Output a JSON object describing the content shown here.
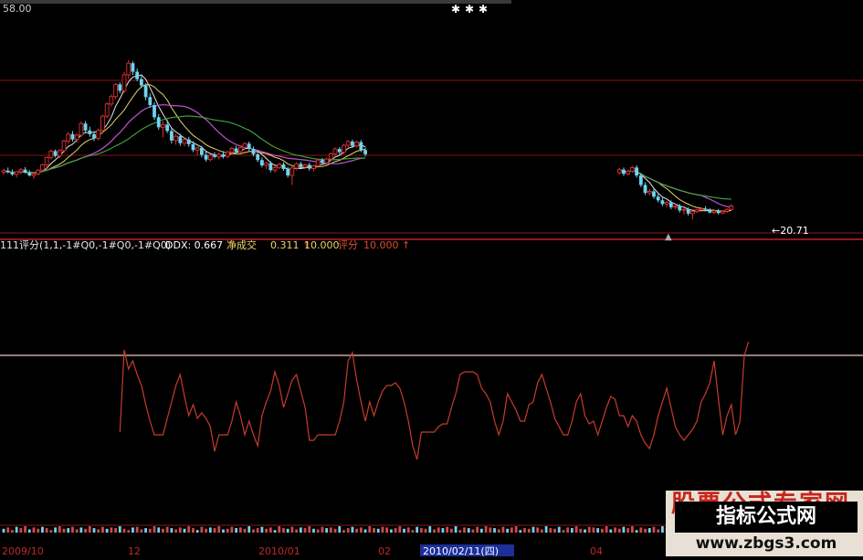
{
  "colors": {
    "background": "#000000",
    "grid": "#8a1414",
    "candle_up": "#e03030",
    "candle_down": "#6fd3ef",
    "ma_white": "#e6e6e6",
    "ma_yellow": "#e8d56a",
    "ma_purple": "#b04fc0",
    "ma_green": "#3fa83f",
    "score_line": "#c83c2c",
    "ref_line": "#e8c8c0",
    "ddx_label": "#ffffff",
    "net_label": "#e8d56a",
    "score_label": "#d84c30"
  },
  "header": {
    "price_top": "58.00",
    "stars": [
      "✱",
      "✱",
      "✱"
    ]
  },
  "indicator_bar": {
    "name": "111评分(1,1,-1#Q0,-1#Q0,-1#Q0)",
    "ddx_label": "DDX: 0.667",
    "ddx_arrow": "↑",
    "net_label": "净成交",
    "net_value": "0.311",
    "net_arrow": "↑",
    "net_value2": "10.000",
    "score_label": "评分",
    "score_value": "10.000",
    "score_arrow": "↑"
  },
  "main_chart": {
    "low_label": "←20.71"
  },
  "x_axis": {
    "labels": [
      "2009/10",
      "12",
      "2010/01",
      "02",
      "2010/02/11(四)",
      "04"
    ]
  },
  "watermark": {
    "top_text": "股票公式专家网",
    "title": "指标公式网",
    "url": "www.zbgs3.com"
  },
  "chart_data": [
    {
      "type": "candlestick",
      "ylim": [
        19,
        58
      ],
      "segments": [
        {
          "first_index": 0,
          "candles": [
            [
              29.6,
              30.3,
              29.1,
              29.9
            ],
            [
              29.9,
              30.5,
              29.4,
              29.6
            ],
            [
              29.6,
              30.1,
              28.9,
              29.2
            ],
            [
              29.2,
              29.9,
              28.6,
              29.7
            ],
            [
              29.7,
              30.4,
              29.2,
              30.1
            ],
            [
              30.1,
              30.6,
              29.4,
              29.5
            ],
            [
              29.5,
              30.0,
              28.8,
              29.0
            ],
            [
              29.0,
              29.6,
              28.4,
              29.3
            ],
            [
              29.3,
              30.2,
              29.0,
              30.0
            ],
            [
              30.0,
              31.2,
              29.7,
              31.0
            ],
            [
              31.0,
              32.6,
              30.6,
              32.4
            ],
            [
              32.4,
              33.9,
              32.0,
              33.6
            ],
            [
              33.6,
              33.9,
              32.4,
              32.7
            ],
            [
              32.7,
              34.0,
              32.2,
              33.7
            ],
            [
              33.7,
              35.8,
              33.3,
              35.5
            ],
            [
              35.5,
              37.2,
              35.0,
              36.8
            ],
            [
              36.8,
              37.4,
              35.4,
              35.8
            ],
            [
              35.8,
              37.0,
              35.2,
              36.6
            ],
            [
              36.6,
              39.2,
              36.2,
              38.8
            ],
            [
              38.8,
              39.3,
              37.0,
              37.5
            ],
            [
              37.5,
              38.2,
              36.3,
              36.8
            ],
            [
              36.8,
              37.4,
              35.5,
              36.0
            ],
            [
              36.0,
              37.9,
              35.6,
              37.5
            ],
            [
              37.5,
              40.5,
              37.1,
              40.2
            ],
            [
              40.2,
              42.8,
              39.8,
              42.5
            ],
            [
              42.5,
              44.3,
              42.0,
              43.9
            ],
            [
              43.9,
              46.5,
              43.4,
              46.2
            ],
            [
              46.2,
              46.6,
              44.5,
              45.0
            ],
            [
              45.0,
              48.5,
              44.6,
              48.0
            ],
            [
              48.0,
              50.8,
              47.2,
              50.2
            ],
            [
              50.2,
              50.6,
              48.0,
              48.6
            ],
            [
              48.6,
              49.2,
              46.8,
              47.2
            ],
            [
              47.2,
              48.0,
              45.5,
              46.0
            ],
            [
              46.0,
              46.4,
              43.2,
              43.8
            ],
            [
              43.8,
              44.5,
              41.8,
              42.3
            ],
            [
              42.3,
              42.8,
              39.5,
              40.0
            ],
            [
              40.0,
              40.6,
              37.6,
              38.1
            ],
            [
              38.1,
              39.2,
              36.2,
              38.6
            ],
            [
              38.6,
              39.5,
              37.0,
              37.4
            ],
            [
              37.4,
              37.9,
              35.0,
              35.6
            ],
            [
              35.6,
              36.8,
              34.8,
              36.4
            ],
            [
              36.4,
              36.9,
              34.6,
              35.1
            ],
            [
              35.1,
              36.2,
              34.5,
              35.8
            ],
            [
              35.8,
              36.3,
              34.4,
              34.9
            ],
            [
              34.9,
              35.4,
              33.4,
              33.8
            ],
            [
              33.8,
              34.5,
              32.8,
              34.2
            ],
            [
              34.2,
              34.6,
              32.4,
              32.9
            ],
            [
              32.9,
              33.5,
              31.6,
              32.0
            ],
            [
              32.0,
              33.0,
              31.6,
              32.8
            ],
            [
              32.8,
              33.4,
              32.2,
              32.5
            ],
            [
              32.5,
              33.3,
              32.0,
              33.0
            ],
            [
              33.0,
              33.6,
              32.2,
              32.6
            ],
            [
              32.6,
              33.7,
              32.2,
              33.4
            ],
            [
              33.4,
              34.4,
              33.0,
              34.1
            ],
            [
              34.1,
              34.6,
              33.2,
              33.5
            ],
            [
              33.5,
              34.6,
              33.2,
              34.3
            ],
            [
              34.3,
              35.3,
              33.9,
              35.0
            ],
            [
              35.0,
              35.4,
              33.6,
              34.0
            ],
            [
              34.0,
              34.5,
              32.6,
              33.0
            ],
            [
              33.0,
              33.5,
              31.5,
              31.9
            ],
            [
              31.9,
              32.4,
              30.5,
              30.9
            ],
            [
              30.9,
              31.6,
              30.2,
              31.3
            ],
            [
              31.3,
              31.7,
              29.6,
              30.0
            ],
            [
              30.0,
              30.8,
              29.5,
              30.5
            ],
            [
              30.5,
              31.4,
              30.2,
              31.1
            ],
            [
              31.1,
              31.5,
              29.9,
              30.2
            ],
            [
              30.2,
              30.6,
              28.6,
              29.0
            ],
            [
              29.0,
              30.8,
              27.2,
              30.4
            ],
            [
              30.4,
              31.5,
              30.0,
              31.2
            ],
            [
              31.2,
              31.6,
              30.3,
              30.6
            ],
            [
              30.6,
              31.3,
              30.2,
              31.0
            ],
            [
              31.0,
              31.4,
              29.9,
              30.3
            ],
            [
              30.3,
              31.0,
              29.8,
              30.8
            ],
            [
              30.8,
              32.2,
              30.5,
              31.9
            ],
            [
              31.9,
              32.3,
              31.0,
              31.4
            ],
            [
              31.4,
              32.4,
              31.0,
              32.1
            ],
            [
              32.1,
              33.4,
              31.8,
              33.1
            ],
            [
              33.1,
              34.3,
              32.7,
              34.0
            ],
            [
              34.0,
              34.4,
              33.0,
              33.4
            ],
            [
              33.4,
              35.0,
              33.0,
              34.7
            ],
            [
              34.7,
              35.7,
              34.2,
              35.4
            ],
            [
              35.4,
              35.8,
              34.2,
              34.6
            ],
            [
              34.6,
              35.6,
              34.2,
              35.3
            ],
            [
              35.3,
              35.7,
              33.4,
              33.8
            ],
            [
              33.8,
              34.3,
              32.6,
              33.0
            ]
          ]
        },
        {
          "first_index": 143,
          "candles": [
            [
              29.5,
              30.4,
              29.2,
              30.1
            ],
            [
              30.1,
              30.5,
              28.9,
              29.3
            ],
            [
              29.3,
              30.1,
              29.0,
              29.8
            ],
            [
              29.8,
              30.8,
              29.5,
              30.5
            ],
            [
              30.5,
              30.9,
              28.6,
              29.0
            ],
            [
              29.0,
              29.4,
              26.8,
              27.2
            ],
            [
              27.2,
              27.7,
              25.3,
              25.7
            ],
            [
              25.7,
              26.4,
              25.2,
              26.0
            ],
            [
              26.0,
              26.5,
              24.6,
              25.0
            ],
            [
              25.0,
              25.5,
              23.9,
              24.3
            ],
            [
              24.3,
              24.8,
              23.2,
              23.6
            ],
            [
              23.6,
              24.2,
              23.0,
              23.9
            ],
            [
              23.9,
              24.3,
              22.6,
              23.0
            ],
            [
              23.0,
              23.6,
              22.6,
              23.2
            ],
            [
              23.2,
              23.6,
              22.0,
              22.4
            ],
            [
              22.4,
              22.9,
              21.6,
              22.6
            ],
            [
              22.6,
              23.0,
              21.4,
              21.8
            ],
            [
              21.8,
              22.4,
              20.7,
              22.2
            ],
            [
              22.2,
              22.7,
              21.9,
              22.5
            ],
            [
              22.5,
              23.0,
              22.1,
              22.7
            ],
            [
              22.7,
              23.2,
              22.2,
              22.5
            ],
            [
              22.5,
              22.8,
              21.8,
              22.0
            ],
            [
              22.0,
              22.6,
              21.7,
              22.3
            ],
            [
              22.3,
              22.7,
              21.6,
              21.9
            ],
            [
              21.9,
              22.4,
              21.7,
              22.2
            ],
            [
              22.2,
              22.8,
              21.9,
              22.6
            ],
            [
              22.6,
              23.6,
              22.3,
              23.2
            ]
          ]
        }
      ]
    },
    {
      "type": "line",
      "ylim": [
        0,
        10
      ],
      "series": [
        {
          "first_index": 27,
          "values": [
            3.4,
            9.4,
            8.0,
            8.6,
            7.6,
            6.8,
            5.4,
            4.2,
            3.2,
            3.2,
            3.2,
            4.4,
            5.6,
            6.8,
            7.6,
            6.0,
            4.6,
            5.4,
            4.4,
            4.8,
            4.4,
            3.8,
            2.0,
            3.2,
            3.2,
            3.2,
            4.2,
            5.6,
            4.6,
            3.2,
            4.2,
            3.2,
            2.4,
            4.6,
            5.6,
            6.4,
            7.8,
            6.8,
            5.2,
            6.2,
            7.2,
            7.6,
            6.4,
            5.2,
            2.8,
            2.8,
            3.2,
            3.2,
            3.2,
            3.2,
            3.2,
            4.2,
            5.6,
            8.6,
            9.2,
            7.2,
            5.6,
            4.2,
            5.6,
            4.6,
            5.6,
            6.4,
            6.8,
            6.8,
            7.0,
            6.6,
            5.6,
            4.2,
            2.4,
            1.4,
            3.4,
            3.4,
            3.4,
            3.4,
            3.8,
            4.0,
            4.0,
            5.2,
            6.2,
            7.6,
            7.8,
            7.8,
            7.8,
            7.6,
            6.6,
            6.2,
            5.6,
            4.2,
            3.2,
            4.2,
            6.2,
            5.6,
            5.0,
            4.2,
            4.2,
            5.4,
            5.6,
            7.0,
            7.6,
            6.6,
            5.6,
            4.4,
            3.8,
            3.2,
            3.2,
            4.2,
            5.6,
            6.2,
            4.6,
            4.0,
            4.2,
            3.2,
            4.2,
            5.2,
            6.0,
            5.8,
            4.6,
            4.6,
            3.8,
            4.6,
            4.2,
            3.2,
            2.6,
            2.2,
            3.2,
            4.6,
            5.6,
            6.6,
            5.2,
            3.8,
            3.2,
            2.8,
            3.2,
            3.6,
            4.2,
            5.6,
            6.2,
            7.0,
            8.6,
            5.8,
            3.2,
            4.6,
            5.4,
            3.2,
            4.2,
            9.0,
            10.0
          ]
        }
      ],
      "reference_line": 9.0
    },
    {
      "type": "bar",
      "categories_count": 198,
      "values": [
        0.6,
        0.8,
        0.4,
        0.9,
        0.7,
        1.0,
        0.5,
        0.8,
        0.6,
        0.9,
        0.7,
        0.4,
        0.8,
        1.0,
        0.6,
        0.7,
        0.9,
        0.5,
        0.8,
        0.6,
        1.0,
        0.7,
        0.5,
        0.9,
        0.6,
        0.8,
        0.7,
        1.0,
        0.6,
        0.4,
        0.8,
        0.9,
        0.5,
        0.7,
        0.6,
        1.0,
        0.8,
        0.6,
        0.9,
        0.7,
        0.5,
        0.8,
        0.6,
        1.0,
        0.7,
        0.4,
        0.9,
        0.6,
        0.8,
        0.7,
        1.0,
        0.5,
        0.6,
        0.9,
        0.7,
        0.8,
        0.6,
        1.0,
        0.5,
        0.7,
        0.9,
        0.6,
        0.8,
        0.4,
        1.0,
        0.7,
        0.6,
        0.9,
        0.5,
        0.8,
        0.7,
        1.0,
        0.6,
        0.5,
        0.9,
        0.7,
        0.8,
        0.6,
        1.0,
        0.4,
        0.7,
        0.9,
        0.6,
        0.8,
        0.5,
        1.0,
        0.7,
        0.6,
        0.9,
        0.8,
        0.5,
        0.7,
        1.0,
        0.6,
        0.8,
        0.4,
        0.9,
        0.7,
        0.6,
        1.0,
        0.5,
        0.8,
        0.7,
        0.9,
        0.6,
        1.0,
        0.4,
        0.8,
        0.7,
        0.5,
        0.9,
        0.6,
        1.0,
        0.8,
        0.7,
        0.5,
        0.9,
        0.6,
        0.8,
        1.0,
        0.4,
        0.7,
        0.6,
        0.9,
        0.8,
        0.5,
        1.0,
        0.7,
        0.6,
        0.9,
        0.4,
        0.8,
        0.7,
        1.0,
        0.6,
        0.5,
        0.9,
        0.8,
        0.7,
        0.6,
        1.0,
        0.5,
        0.8,
        0.6,
        0.9,
        0.7,
        1.0,
        0.4,
        0.8,
        0.6,
        0.7,
        0.9,
        0.5,
        1.0,
        0.8,
        0.6,
        0.7,
        0.9,
        0.4,
        1.0,
        0.6,
        0.8,
        0.7,
        0.5,
        0.9,
        0.6,
        1.0,
        0.8,
        0.4,
        0.7,
        0.9,
        0.6,
        0.5,
        1.0,
        0.8,
        0.7,
        0.6,
        0.9,
        0.5,
        1.0,
        0.7,
        0.8,
        0.6,
        0.4,
        0.9,
        1.0,
        0.7,
        0.6,
        0.8,
        0.5,
        0.9,
        0.7,
        1.0,
        0.6
      ]
    }
  ]
}
